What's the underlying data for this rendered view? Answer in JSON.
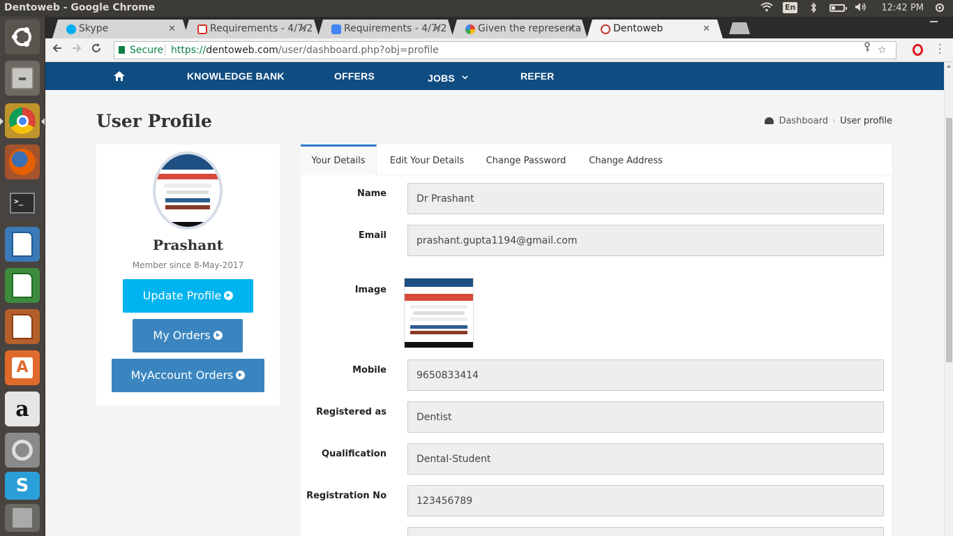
{
  "window_title": "Dentoweb - Google Chrome",
  "system_tray": {
    "language": "En",
    "clock": "12:42 PM"
  },
  "tabs": [
    {
      "label": "Skype",
      "icon": "skype-icon"
    },
    {
      "label": "Requirements - 4/7/2",
      "icon": "gmail-icon"
    },
    {
      "label": "Requirements - 4/7/2",
      "icon": "docs-icon"
    },
    {
      "label": "Given the representa",
      "icon": "google-icon"
    },
    {
      "label": "Dentoweb",
      "icon": "dentoweb-icon",
      "active": true
    }
  ],
  "omnibox": {
    "secure_label": "Secure",
    "scheme": "https://",
    "host": "dentoweb.com",
    "path": "/user/dashboard.php?obj=profile"
  },
  "nav": {
    "knowledge_bank": "KNOWLEDGE BANK",
    "offers": "OFFERS",
    "jobs": "JOBS",
    "refer": "REFER"
  },
  "page": {
    "title": "User Profile",
    "breadcrumb": {
      "dashboard": "Dashboard",
      "current": "User profile"
    }
  },
  "profile": {
    "name": "Prashant",
    "member_since": "Member since 8-May-2017",
    "update_button": "Update Profile",
    "orders_button": "My Orders",
    "account_orders_button": "MyAccount Orders"
  },
  "details_tabs": {
    "your_details": "Your Details",
    "edit_details": "Edit Your Details",
    "change_password": "Change Password",
    "change_address": "Change Address"
  },
  "fields": {
    "name_label": "Name",
    "name_value": "Dr Prashant",
    "email_label": "Email",
    "email_value": "prashant.gupta1194@gmail.com",
    "image_label": "Image",
    "mobile_label": "Mobile",
    "mobile_value": "9650833414",
    "registered_label": "Registered as",
    "registered_value": "Dentist",
    "qualification_label": "Qualification",
    "qualification_value": "Dental-Student",
    "regno_label": "Registration No",
    "regno_value": "123456789"
  },
  "colors": {
    "navbar": "#0f4c81",
    "update_button": "#00b4ef",
    "orders_button": "#3a85bf",
    "secure_green": "#0b8043"
  }
}
